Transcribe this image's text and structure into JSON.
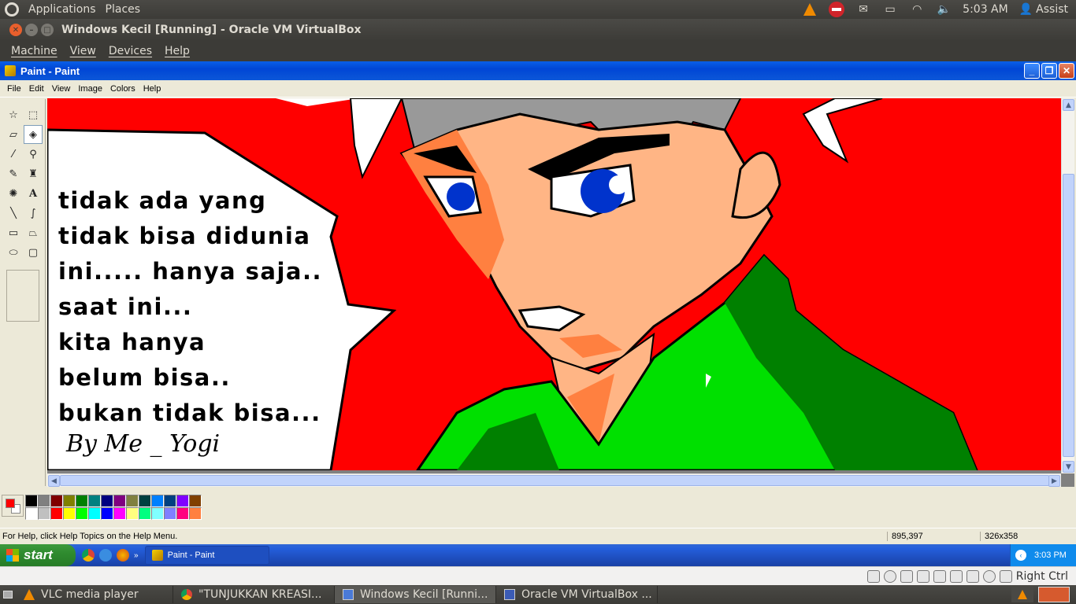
{
  "top_panel": {
    "menu": [
      "Applications",
      "Places"
    ],
    "clock": "5:03 AM",
    "user": "Assist"
  },
  "vbox": {
    "title": "Windows Kecil [Running] - Oracle VM VirtualBox",
    "menu": [
      "Machine",
      "View",
      "Devices",
      "Help"
    ],
    "host_key": "Right Ctrl"
  },
  "paint": {
    "title": "Paint - Paint",
    "menu": [
      "File",
      "Edit",
      "View",
      "Image",
      "Colors",
      "Help"
    ],
    "canvas_text": [
      "tidak ada yang",
      "tidak bisa didunia",
      "ini..... hanya saja..",
      "saat ini...",
      "kita hanya",
      "belum bisa..",
      "bukan tidak bisa..."
    ],
    "signature": "By Me _ Yogi",
    "status_help": "For Help, click Help Topics on the Help Menu.",
    "cursor_pos": "895,397",
    "canvas_size": "326x358",
    "fg_color": "#ff0000",
    "bg_color": "#ffffff",
    "palette_top": [
      "#000000",
      "#808080",
      "#800000",
      "#808000",
      "#008000",
      "#008080",
      "#000080",
      "#800080",
      "#808040",
      "#004040",
      "#0080ff",
      "#004080",
      "#8000ff",
      "#804000"
    ],
    "palette_bottom": [
      "#ffffff",
      "#c0c0c0",
      "#ff0000",
      "#ffff00",
      "#00ff00",
      "#00ffff",
      "#0000ff",
      "#ff00ff",
      "#ffff80",
      "#00ff80",
      "#80ffff",
      "#8080ff",
      "#ff0080",
      "#ff8040"
    ]
  },
  "xp_taskbar": {
    "start": "start",
    "task": "Paint - Paint",
    "clock": "3:03 PM"
  },
  "bottom_panel": {
    "items": [
      "VLC media player",
      "\"TUNJUKKAN KREASI...",
      "Windows Kecil [Runni...",
      "Oracle VM VirtualBox ..."
    ]
  }
}
